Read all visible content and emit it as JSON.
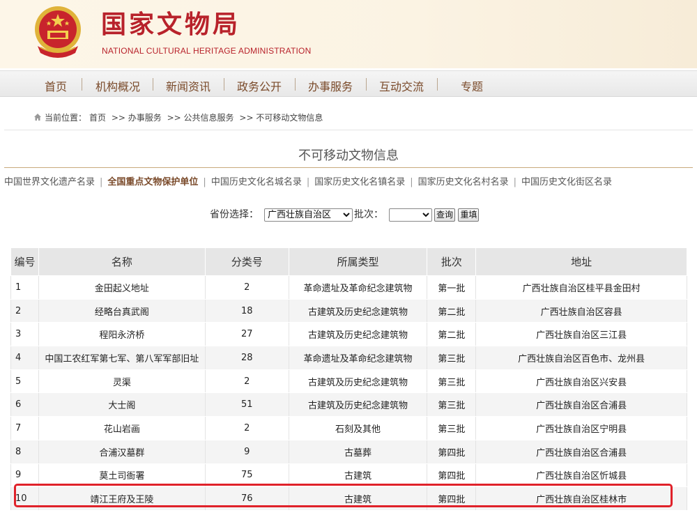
{
  "header": {
    "title": "国家文物局",
    "subtitle": "NATIONAL  CULTURAL HERITAGE ADMINISTRATION"
  },
  "nav": {
    "items": [
      "首页",
      "机构概况",
      "新闻资讯",
      "政务公开",
      "办事服务",
      "互动交流",
      "专题"
    ]
  },
  "breadcrumb": {
    "prefix": "当前位置：",
    "items": [
      "首页",
      ">> 办事服务",
      ">> 公共信息服务",
      ">> 不可移动文物信息"
    ]
  },
  "page_title": "不可移动文物信息",
  "category_links": [
    {
      "label": "中国世界文化遗产名录",
      "active": false
    },
    {
      "label": "全国重点文物保护单位",
      "active": true
    },
    {
      "label": "中国历史文化名城名录",
      "active": false
    },
    {
      "label": "国家历史文化名镇名录",
      "active": false
    },
    {
      "label": "国家历史文化名村名录",
      "active": false
    },
    {
      "label": "中国历史文化街区名录",
      "active": false
    }
  ],
  "filter": {
    "province_label": "省份选择：",
    "province_value": "广西壮族自治区",
    "batch_label": "批次：",
    "batch_value": "",
    "query_button": "查询",
    "reset_button": "重填"
  },
  "table": {
    "headers": [
      "编号",
      "名称",
      "分类号",
      "所属类型",
      "批次",
      "地址"
    ],
    "rows": [
      [
        "1",
        "金田起义地址",
        "2",
        "革命遗址及革命纪念建筑物",
        "第一批",
        "广西壮族自治区桂平县金田村"
      ],
      [
        "2",
        "经略台真武阁",
        "18",
        "古建筑及历史纪念建筑物",
        "第二批",
        "广西壮族自治区容县"
      ],
      [
        "3",
        "程阳永济桥",
        "27",
        "古建筑及历史纪念建筑物",
        "第二批",
        "广西壮族自治区三江县"
      ],
      [
        "4",
        "中国工农红军第七军、第八军军部旧址",
        "28",
        "革命遗址及革命纪念建筑物",
        "第三批",
        "广西壮族自治区百色市、龙州县"
      ],
      [
        "5",
        "灵渠",
        "2",
        "古建筑及历史纪念建筑物",
        "第三批",
        "广西壮族自治区兴安县"
      ],
      [
        "6",
        "大士阁",
        "51",
        "古建筑及历史纪念建筑物",
        "第三批",
        "广西壮族自治区合浦县"
      ],
      [
        "7",
        "花山岩画",
        "2",
        "石刻及其他",
        "第三批",
        "广西壮族自治区宁明县"
      ],
      [
        "8",
        "合浦汉墓群",
        "9",
        "古墓葬",
        "第四批",
        "广西壮族自治区合浦县"
      ],
      [
        "9",
        "莫土司衙署",
        "75",
        "古建筑",
        "第四批",
        "广西壮族自治区忻城县"
      ],
      [
        "10",
        "靖江王府及王陵",
        "76",
        "古建筑",
        "第四批",
        "广西壮族自治区桂林市"
      ]
    ]
  },
  "colors": {
    "brand_red": "#b8222b",
    "nav_text": "#7a4a2a",
    "highlight_red": "#e0222a"
  }
}
